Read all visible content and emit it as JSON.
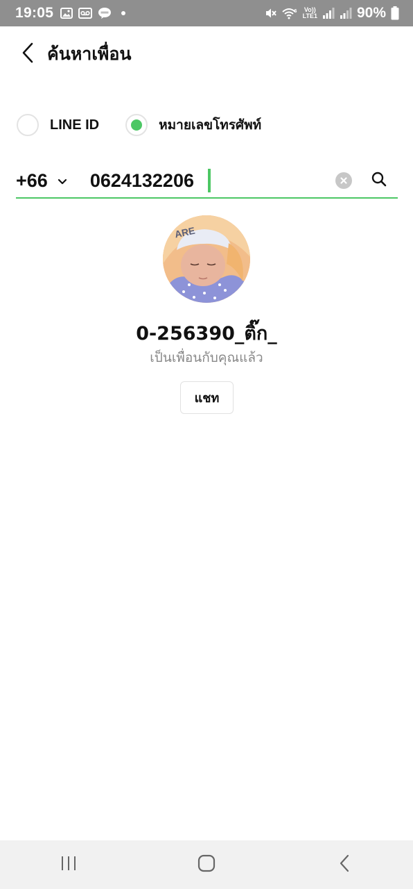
{
  "status_bar": {
    "time": "19:05",
    "volte_top": "Vo))",
    "volte_bottom": "LTE1",
    "battery": "90%"
  },
  "header": {
    "title": "ค้นหาเพื่อน"
  },
  "search_type": {
    "options": [
      {
        "label": "LINE ID",
        "selected": false
      },
      {
        "label": "หมายเลขโทรศัพท์",
        "selected": true
      }
    ]
  },
  "search": {
    "country_code": "+66",
    "phone_value": "0624132206"
  },
  "result": {
    "name": "0-256390_ติ๊ก_",
    "status": "เป็นเพื่อนกับคุณแล้ว",
    "chat_label": "แชท"
  },
  "colors": {
    "accent": "#4cc764",
    "status_bar": "#8f8f8f",
    "nav_bar": "#f1f1f1",
    "secondary_text": "#888888"
  },
  "icons": {
    "back": "chevron-left-icon",
    "dropdown": "chevron-down-icon",
    "clear": "clear-circle-icon",
    "search": "search-icon",
    "nav_recents": "recents-icon",
    "nav_home": "home-icon",
    "nav_back": "back-icon"
  }
}
